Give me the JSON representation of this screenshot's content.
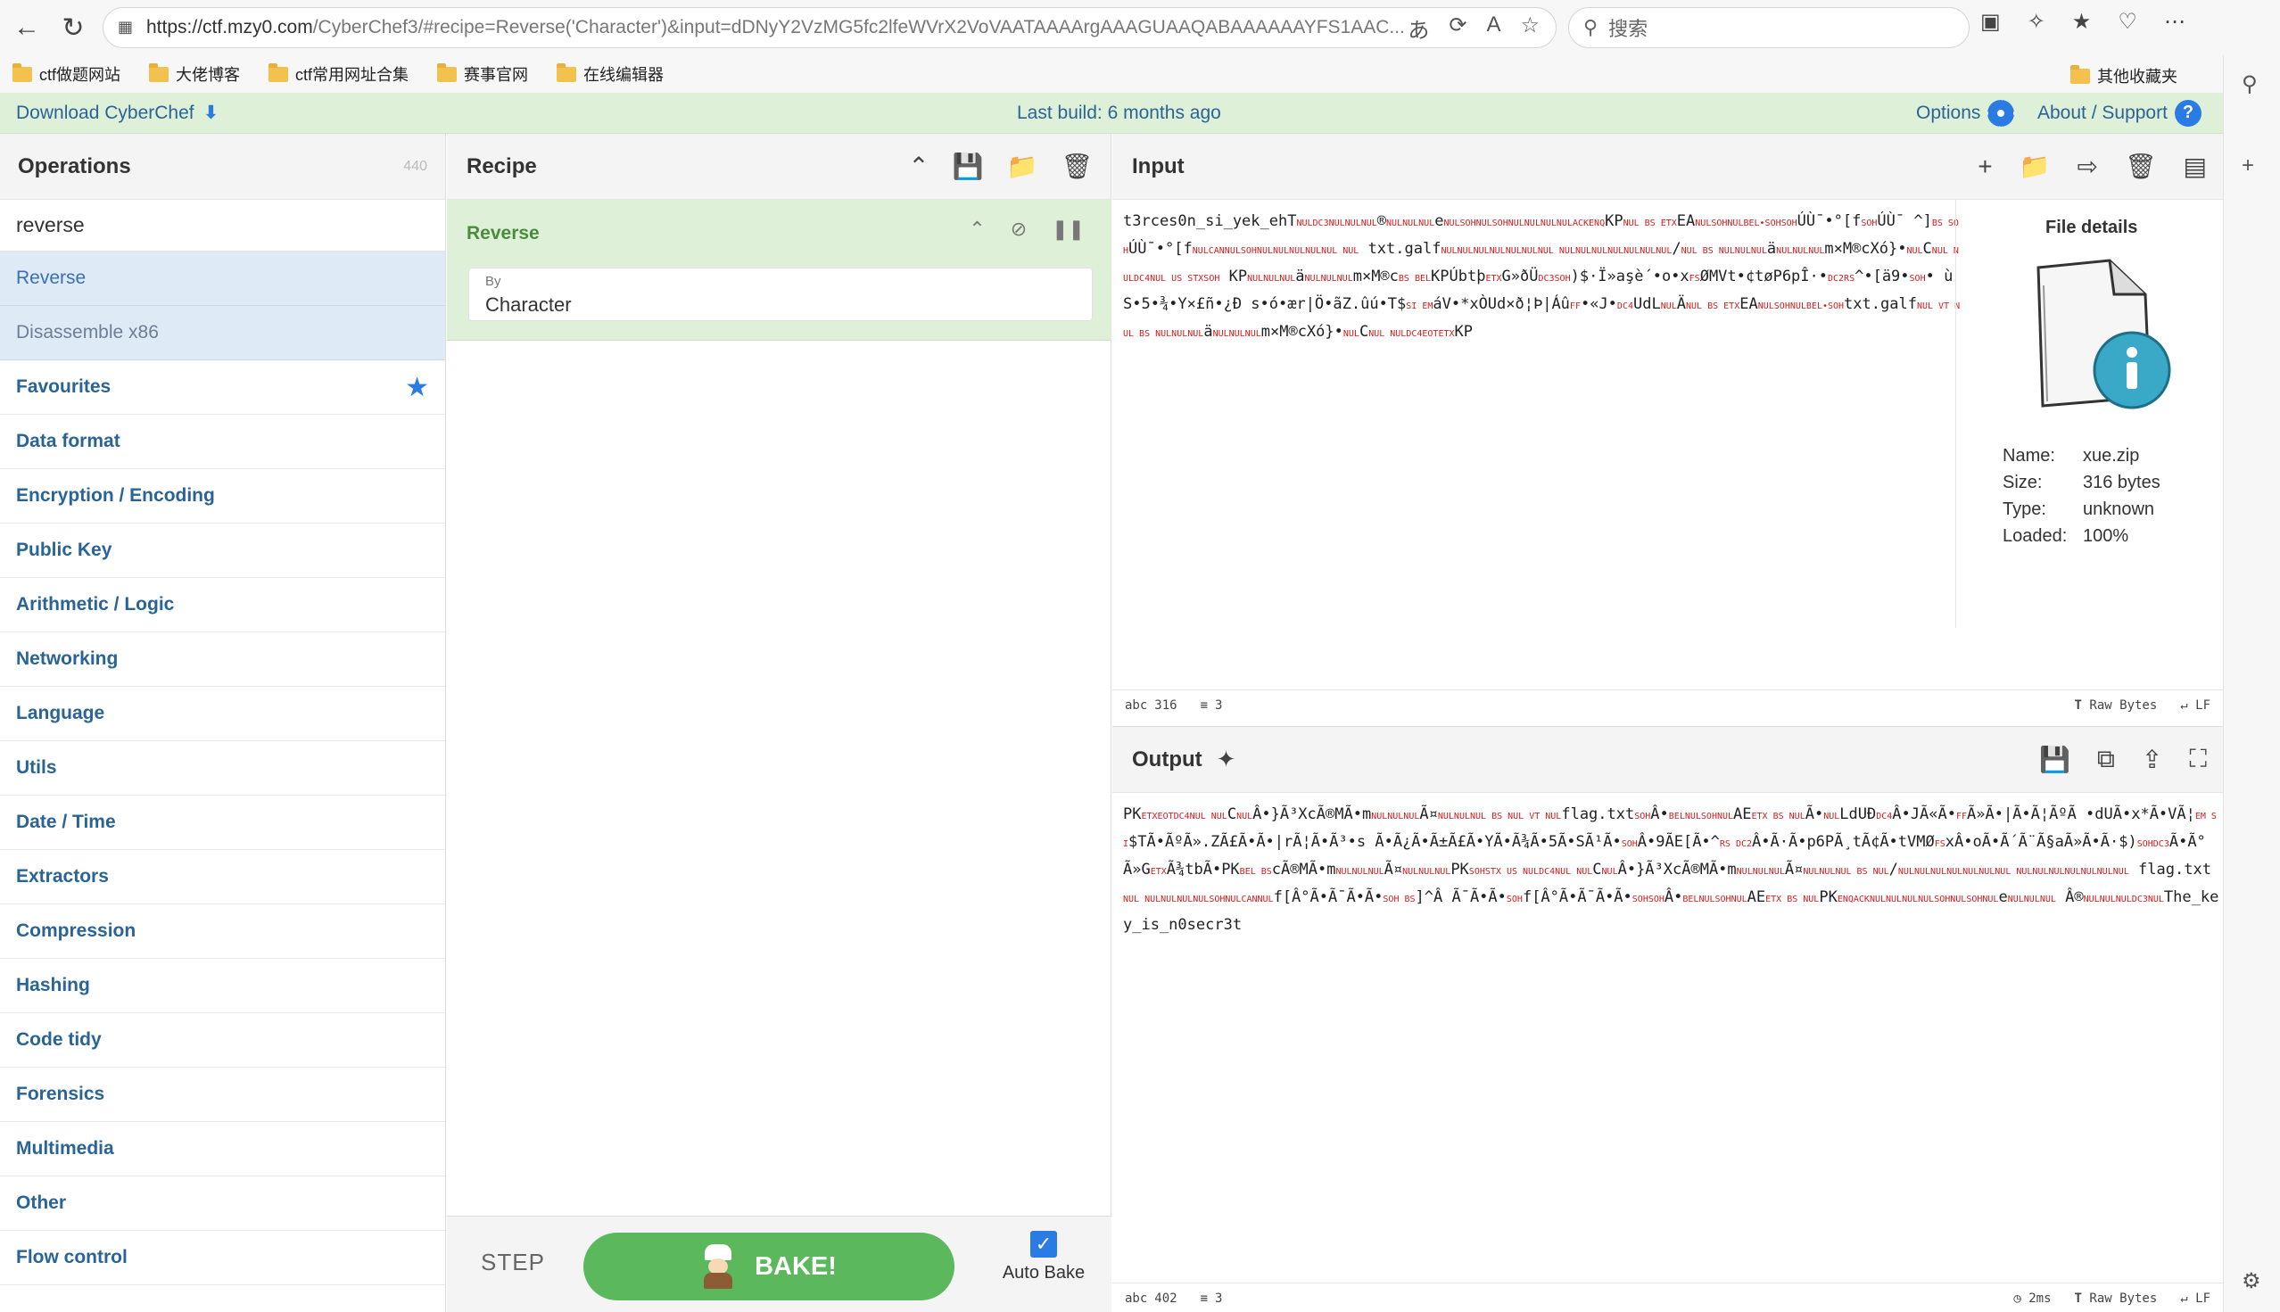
{
  "browser": {
    "url_main": "https://ctf.mzy0.com",
    "url_rest": "/CyberChef3/#recipe=Reverse('Character')&input=dDNyY2VzMG5fc2lfeWVrX2VoVAATAAAArgAAAGUAAQABAAAAAAYFS1AAC...",
    "search_placeholder": "搜索",
    "bookmarks": [
      "ctf做题网站",
      "大佬博客",
      "ctf常用网址合集",
      "赛事官网",
      "在线编辑器"
    ],
    "bookmark_right": "其他收藏夹"
  },
  "banner": {
    "download": "Download CyberChef",
    "build": "Last build: 6 months ago",
    "options": "Options",
    "about": "About / Support"
  },
  "operations": {
    "title": "Operations",
    "count": "440",
    "search_value": "reverse",
    "results": [
      "Reverse",
      "Disassemble x86"
    ],
    "categories": [
      "Favourites",
      "Data format",
      "Encryption / Encoding",
      "Public Key",
      "Arithmetic / Logic",
      "Networking",
      "Language",
      "Utils",
      "Date / Time",
      "Extractors",
      "Compression",
      "Hashing",
      "Code tidy",
      "Forensics",
      "Multimedia",
      "Other",
      "Flow control"
    ]
  },
  "recipe": {
    "title": "Recipe",
    "op_name": "Reverse",
    "arg_label": "By",
    "arg_value": "Character",
    "step": "STEP",
    "bake": "BAKE!",
    "auto_bake": "Auto Bake"
  },
  "input": {
    "title": "Input",
    "status_chars": "316",
    "status_lines": "3",
    "status_raw": "Raw Bytes",
    "status_eol": "LF"
  },
  "file_details": {
    "title": "File details",
    "name_label": "Name:",
    "name": "xue.zip",
    "size_label": "Size:",
    "size": "316 bytes",
    "type_label": "Type:",
    "type": "unknown",
    "loaded_label": "Loaded:",
    "loaded": "100%"
  },
  "output": {
    "title": "Output",
    "status_chars": "402",
    "status_lines": "3",
    "status_time": "2ms",
    "status_raw": "Raw Bytes",
    "status_eol": "LF",
    "readable_flag": "flag.txt",
    "readable_key": "The_key_is_n0secr3t"
  },
  "icons": {
    "accent": "#2a7be4",
    "success": "#5cb85c",
    "control_char": "#d02020"
  }
}
